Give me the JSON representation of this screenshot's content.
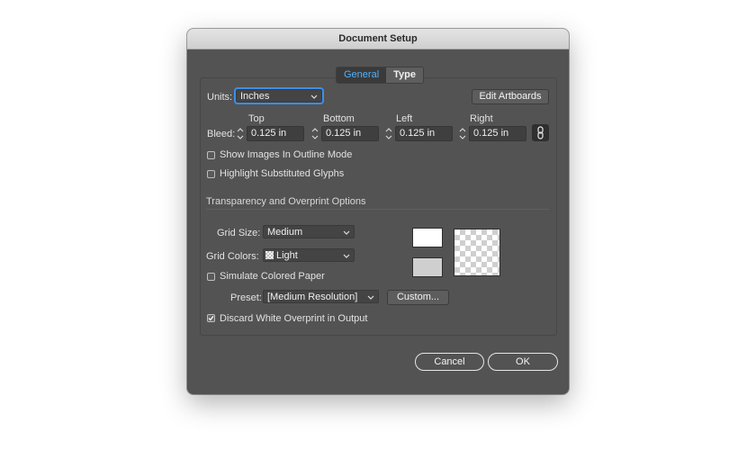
{
  "dialog": {
    "title": "Document Setup"
  },
  "tabs": [
    {
      "label": "General",
      "active": true
    },
    {
      "label": "Type",
      "active": false
    }
  ],
  "units": {
    "label": "Units:",
    "value": "Inches"
  },
  "edit_artboards_label": "Edit Artboards",
  "bleed": {
    "label": "Bleed:",
    "top": {
      "label": "Top",
      "value": "0.125 in"
    },
    "bottom": {
      "label": "Bottom",
      "value": "0.125 in"
    },
    "left": {
      "label": "Left",
      "value": "0.125 in"
    },
    "right": {
      "label": "Right",
      "value": "0.125 in"
    },
    "link_icon": "chain-link-icon"
  },
  "options": {
    "show_images_outline": {
      "label": "Show Images In Outline Mode",
      "checked": false
    },
    "highlight_glyphs": {
      "label": "Highlight Substituted Glyphs",
      "checked": false
    }
  },
  "transparency": {
    "section_title": "Transparency and Overprint Options",
    "grid_size": {
      "label": "Grid Size:",
      "value": "Medium"
    },
    "grid_colors": {
      "label": "Grid Colors:",
      "value": "Light"
    },
    "simulate_paper": {
      "label": "Simulate Colored Paper",
      "checked": false
    },
    "preset": {
      "label": "Preset:",
      "value": "[Medium Resolution]"
    },
    "custom_label": "Custom...",
    "discard_white": {
      "label": "Discard White Overprint in Output",
      "checked": true
    },
    "swatch_top_color": "#ffffff",
    "swatch_bottom_color": "#cfcfcf"
  },
  "footer": {
    "cancel_label": "Cancel",
    "ok_label": "OK"
  }
}
